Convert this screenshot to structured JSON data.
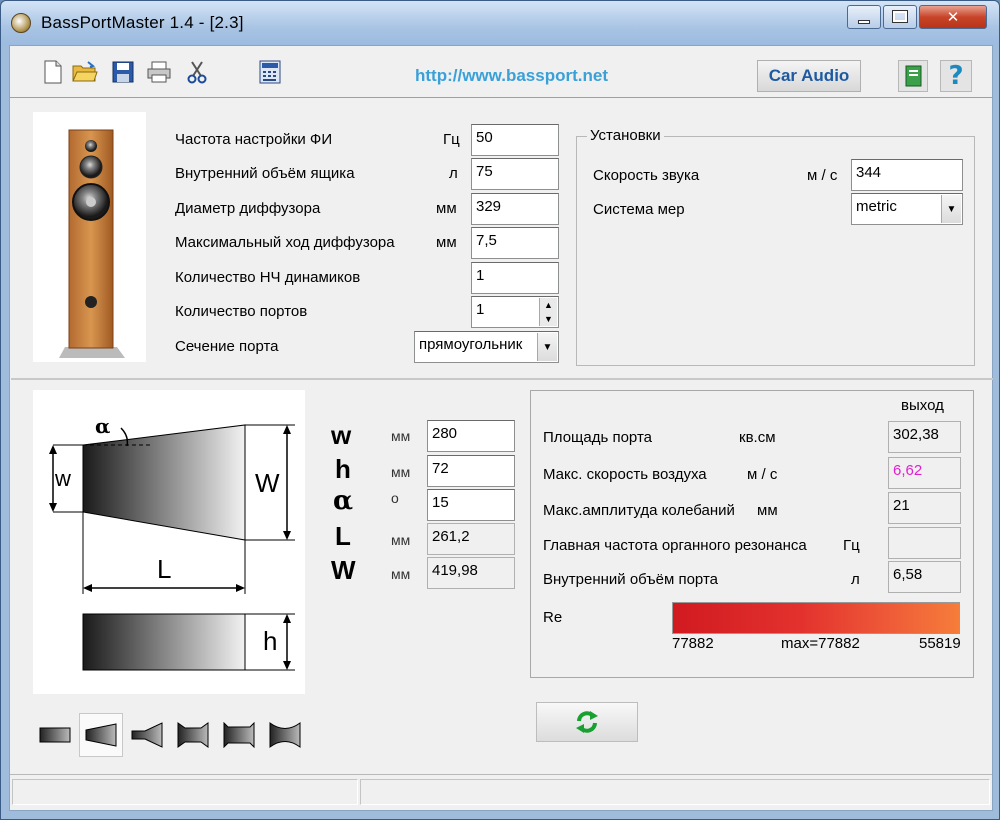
{
  "window": {
    "title": "BassPortMaster 1.4  - [2.3]"
  },
  "toolbar": {
    "icons": [
      "new-file-icon",
      "open-folder-icon",
      "save-icon",
      "print-icon",
      "cut-icon",
      "calculator-icon"
    ],
    "url": "http://www.bassport.net",
    "car_audio_label": "Car Audio",
    "help_label": "?"
  },
  "params": {
    "rows": [
      {
        "label": "Частота настройки ФИ",
        "unit": "Гц",
        "value": "50"
      },
      {
        "label": "Внутренний объём ящика",
        "unit": "л",
        "value": "75"
      },
      {
        "label": "Диаметр диффузора",
        "unit": "мм",
        "value": "329"
      },
      {
        "label": "Максимальный ход диффузора",
        "unit": "мм",
        "value": "7,5"
      },
      {
        "label": "Количество НЧ динамиков",
        "unit": "",
        "value": "1"
      },
      {
        "label": "Количество портов",
        "unit": "",
        "value": "1"
      },
      {
        "label": "Сечение порта",
        "unit": "",
        "value": "прямоугольник"
      }
    ]
  },
  "settings": {
    "title": "Установки",
    "sound_speed_label": "Скорость звука",
    "sound_speed_unit": "м / с",
    "sound_speed_value": "344",
    "measure_label": "Система мер",
    "measure_value": "metric"
  },
  "dimensions": {
    "rows": [
      {
        "sym": "w",
        "unit": "мм",
        "value": "280"
      },
      {
        "sym": "h",
        "unit": "мм",
        "value": "72"
      },
      {
        "sym": "α",
        "unit": "o",
        "value": "15"
      },
      {
        "sym": "L",
        "unit": "мм",
        "value": "261,2"
      },
      {
        "sym": "W",
        "unit": "мм",
        "value": "419,98"
      }
    ]
  },
  "diagram": {
    "alpha": "α",
    "w": "w",
    "W": "W",
    "L": "L",
    "h": "h"
  },
  "results": {
    "header": "выход",
    "rows": [
      {
        "label": "Площадь порта",
        "unit": "кв.см",
        "value": "302,38",
        "color": "#000000"
      },
      {
        "label": "Макс. скорость воздуха",
        "unit": "м / с",
        "value": "6,62",
        "color": "#e020d0"
      },
      {
        "label": "Макс.амплитуда колебаний",
        "unit": "мм",
        "value": "21",
        "color": "#000000"
      },
      {
        "label": "Главная частота органного резонанса",
        "unit": "Гц",
        "value": "",
        "color": "#000000"
      },
      {
        "label": "Внутренний объём порта",
        "unit": "л",
        "value": "6,58",
        "color": "#000000"
      }
    ],
    "re_label": "Re",
    "re_min": "77882",
    "re_max": "max=77882",
    "re_end": "55819"
  },
  "shapes": [
    "rectangle-port-icon",
    "tapered-port-icon",
    "horn-port-icon",
    "double-flare-port-icon",
    "i-beam-port-icon",
    "bowtie-port-icon"
  ],
  "refresh_icon": "refresh-icon"
}
